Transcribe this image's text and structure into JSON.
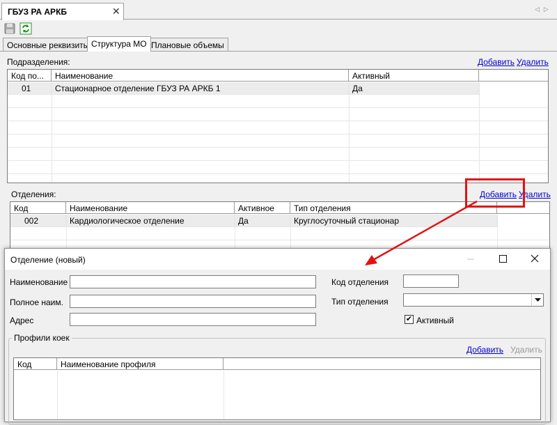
{
  "document_tab": {
    "title": "ГБУЗ РА АРКБ",
    "close_glyph": "✕",
    "scroll_glyph": "◁▷"
  },
  "inner_tabs": [
    {
      "label": "Основные реквизиты"
    },
    {
      "label": "Структура МО"
    },
    {
      "label": "Плановые объемы"
    }
  ],
  "subdivisions": {
    "label": "Подразделения:",
    "add_label": "Добавить",
    "delete_label": "Удалить",
    "columns": [
      "Код по...",
      "Наименование",
      "Активный"
    ],
    "rows": [
      {
        "code": "01",
        "name": "Стационарное отделение ГБУЗ РА АРКБ 1",
        "active": "Да"
      }
    ]
  },
  "departments": {
    "label": "Отделения:",
    "add_label": "Добавить",
    "delete_label": "Удалить",
    "columns": [
      "Код",
      "Наименование",
      "Активное",
      "Тип отделения"
    ],
    "rows": [
      {
        "code": "002",
        "name": "Кардиологическое отделение",
        "active": "Да",
        "type": "Круглосуточный стационар"
      }
    ]
  },
  "dialog": {
    "title": "Отделение (новый)",
    "name_label": "Наименование",
    "name_value": "",
    "full_name_label": "Полное наим.",
    "full_name_value": "",
    "address_label": "Адрес",
    "address_value": "",
    "code_label": "Код отделения",
    "code_value": "",
    "type_label": "Тип отделения",
    "type_value": "",
    "active_label": "Активный",
    "active_checked": true,
    "check_glyph": "✔",
    "profiles": {
      "group_label": "Профили коек",
      "add_label": "Добавить",
      "delete_label": "Удалить",
      "columns": [
        "Код",
        "Наименование профиля"
      ]
    }
  },
  "colors": {
    "annotation_red": "#e21212",
    "link_blue": "#0000cc"
  }
}
